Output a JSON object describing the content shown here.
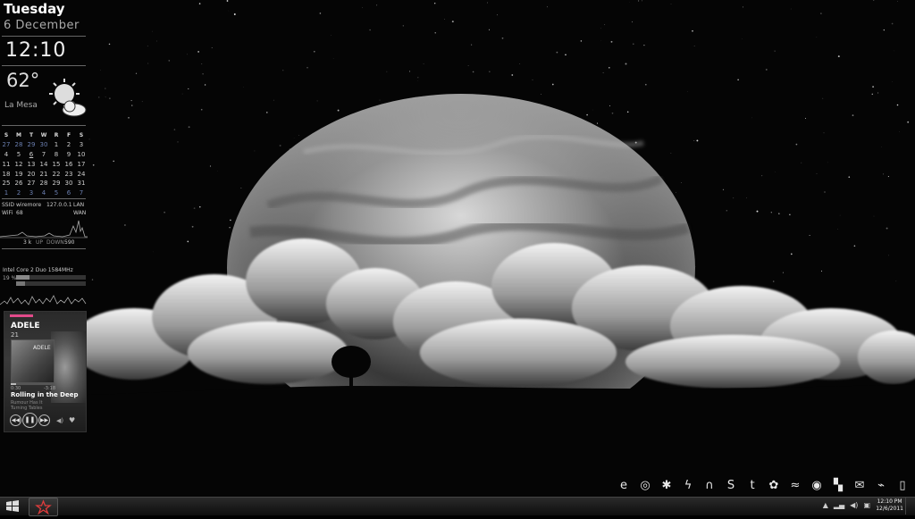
{
  "widgets": {
    "day": "Tuesday",
    "date": "6 December",
    "time": "12:10",
    "temperature": "62°",
    "location": "La Mesa",
    "weather_icon": "partly-cloudy-icon",
    "calendar": {
      "headers": [
        "S",
        "M",
        "T",
        "W",
        "R",
        "F",
        "S"
      ],
      "weeks": [
        [
          "27",
          "28",
          "29",
          "30",
          "1",
          "2",
          "3"
        ],
        [
          "4",
          "5",
          "6",
          "7",
          "8",
          "9",
          "10"
        ],
        [
          "11",
          "12",
          "13",
          "14",
          "15",
          "16",
          "17"
        ],
        [
          "18",
          "19",
          "20",
          "21",
          "22",
          "23",
          "24"
        ],
        [
          "25",
          "26",
          "27",
          "28",
          "29",
          "30",
          "31"
        ],
        [
          "1",
          "2",
          "3",
          "4",
          "5",
          "6",
          "7"
        ]
      ],
      "muted_first_row_count": 4,
      "muted_last_row": true,
      "today": "6"
    },
    "network": {
      "ssid_label": "SSID",
      "ssid": "wiremore",
      "ip": "127.0.0.1",
      "lan_label": "LAN",
      "wifi_label": "WiFi",
      "signal": "68",
      "wan_label": "WAN",
      "up_value": "3 k",
      "up_label": "UP",
      "down_label": "DOWN",
      "down_value": "590"
    },
    "cpu": {
      "label": "Intel Core 2 Duo 1584MHz",
      "percent": "19 %"
    },
    "player": {
      "artist": "ADELE",
      "album": "21",
      "cover_text": "ADELE",
      "elapsed": "0:30",
      "remaining": "-3:18",
      "progress": 0.13,
      "song": "Rolling in the Deep",
      "sub1": "Rumour Has It",
      "sub2": "Turning Tables",
      "accent": "#e24a8a"
    }
  },
  "dock": {
    "icons": [
      "ie-icon",
      "chrome-icon",
      "zune-icon",
      "winamp-icon",
      "headphones-icon",
      "skype-icon",
      "twitter-icon",
      "paint-icon",
      "fox-icon",
      "aperture-icon",
      "grid-icon",
      "mail-icon",
      "recycle-icon",
      "bin-icon"
    ],
    "glyphs": [
      "e",
      "◎",
      "✱",
      "ϟ",
      "∩",
      "S",
      "t",
      "✿",
      "≈",
      "◉",
      "▚",
      "✉",
      "⌁",
      "▯"
    ]
  },
  "taskbar": {
    "tray_icons": [
      "▲",
      "▂▄",
      "◀)",
      "▣"
    ],
    "time": "12:10 PM",
    "date": "12/6/2011"
  },
  "colors": {
    "accent": "#e24a8a",
    "calendar_muted": "#6b7fb0"
  }
}
